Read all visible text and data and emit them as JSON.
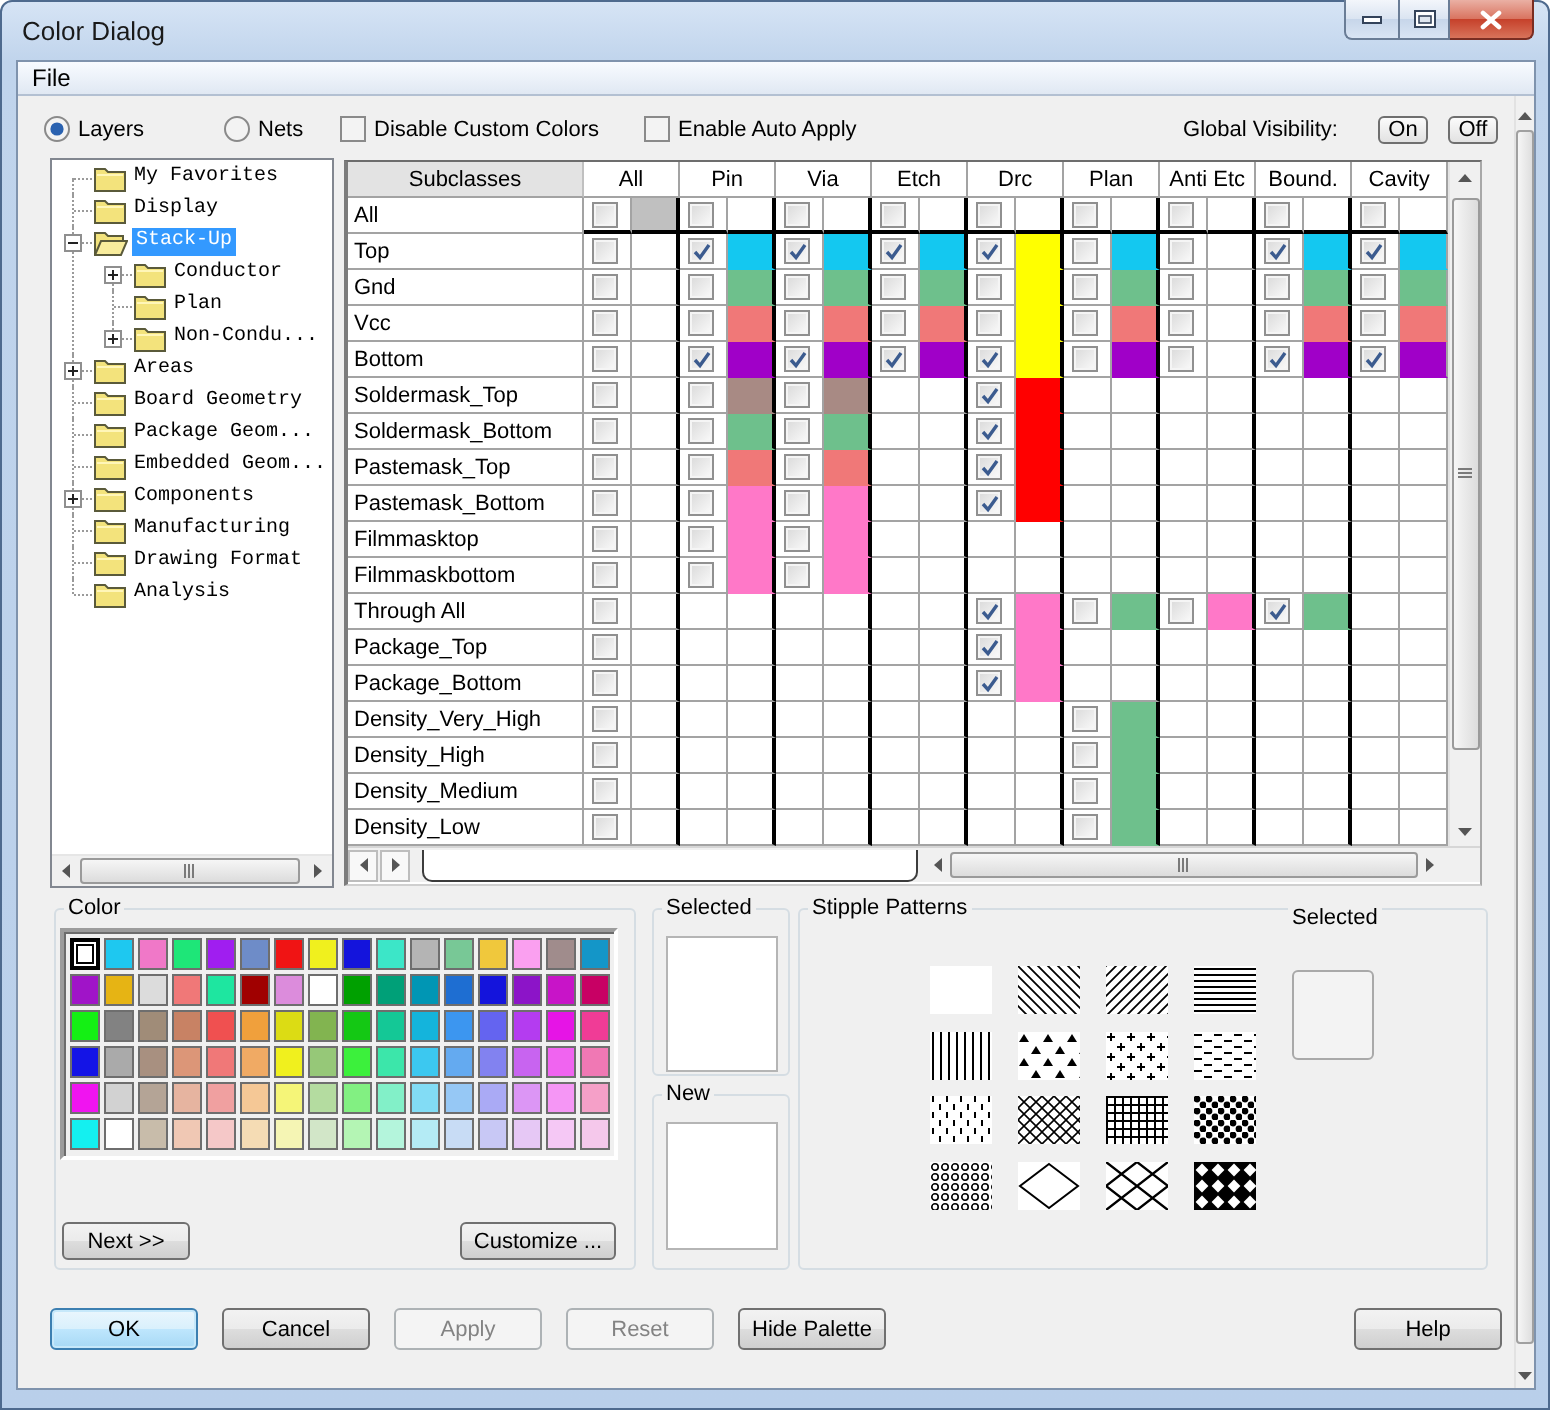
{
  "window": {
    "title": "Color Dialog"
  },
  "menu_bar": [
    "File"
  ],
  "view_options": [
    {
      "label": "Layers",
      "selected": true
    },
    {
      "label": "Nets",
      "selected": false
    }
  ],
  "options": [
    {
      "label": "Disable Custom Colors",
      "checked": false
    },
    {
      "label": "Enable Auto Apply",
      "checked": false
    }
  ],
  "global_visibility": {
    "label": "Global Visibility:",
    "buttons": [
      "On",
      "Off"
    ]
  },
  "tree": [
    {
      "label": "My Favorites",
      "selected": false
    },
    {
      "label": "Display",
      "selected": false
    },
    {
      "label": "Stack-Up",
      "selected": true,
      "expanded": true,
      "children": [
        {
          "label": "Conductor",
          "selected": false,
          "expanded": false
        },
        {
          "label": "Plan",
          "selected": false
        },
        {
          "label": "Non-Condu...",
          "selected": false,
          "expanded": false
        }
      ]
    },
    {
      "label": "Areas",
      "selected": false,
      "expanded": false
    },
    {
      "label": "Board Geometry",
      "selected": false
    },
    {
      "label": "Package Geom...",
      "selected": false
    },
    {
      "label": "Embedded Geom...",
      "selected": false
    },
    {
      "label": "Components",
      "selected": false,
      "expanded": false
    },
    {
      "label": "Manufacturing",
      "selected": false
    },
    {
      "label": "Drawing Format",
      "selected": false
    },
    {
      "label": "Analysis",
      "selected": false
    }
  ],
  "table": {
    "columns": [
      "Subclasses",
      "All",
      "Pin",
      "Via",
      "Etch",
      "Drc",
      "Plan",
      "Anti Etc",
      "Bound.",
      "Cavity"
    ],
    "rows": [
      {
        "name": "All",
        "cells": [
          {
            "kind": "toggle",
            "checked": false,
            "color": "#c0c0c0"
          },
          {
            "kind": "toggle",
            "checked": false
          },
          {
            "kind": "toggle",
            "checked": false
          },
          {
            "kind": "toggle",
            "checked": false
          },
          {
            "kind": "toggle",
            "checked": false
          },
          {
            "kind": "toggle",
            "checked": false
          },
          {
            "kind": "toggle",
            "checked": false
          },
          {
            "kind": "toggle",
            "checked": false
          },
          {
            "kind": "toggle",
            "checked": false
          }
        ]
      },
      {
        "name": "Top",
        "cells": [
          {
            "kind": "toggle",
            "checked": false
          },
          {
            "kind": "toggle",
            "checked": true,
            "color": "#14c8f0"
          },
          {
            "kind": "toggle",
            "checked": true,
            "color": "#14c8f0"
          },
          {
            "kind": "toggle",
            "checked": true,
            "color": "#14c8f0"
          },
          {
            "kind": "toggle",
            "checked": true,
            "color": "#ffff00"
          },
          {
            "kind": "toggle",
            "checked": false,
            "color": "#14c8f0"
          },
          {
            "kind": "toggle",
            "checked": false
          },
          {
            "kind": "toggle",
            "checked": true,
            "color": "#14c8f0"
          },
          {
            "kind": "toggle",
            "checked": true,
            "color": "#14c8f0"
          }
        ]
      },
      {
        "name": "Gnd",
        "cells": [
          {
            "kind": "toggle",
            "checked": false
          },
          {
            "kind": "toggle",
            "checked": false,
            "color": "#6ec08c"
          },
          {
            "kind": "toggle",
            "checked": false,
            "color": "#6ec08c"
          },
          {
            "kind": "toggle",
            "checked": false,
            "color": "#6ec08c"
          },
          {
            "kind": "toggle",
            "checked": false,
            "color": "#ffff00"
          },
          {
            "kind": "toggle",
            "checked": false,
            "color": "#6ec08c"
          },
          {
            "kind": "toggle",
            "checked": false
          },
          {
            "kind": "toggle",
            "checked": false,
            "color": "#6ec08c"
          },
          {
            "kind": "toggle",
            "checked": false,
            "color": "#6ec08c"
          }
        ]
      },
      {
        "name": "Vcc",
        "cells": [
          {
            "kind": "toggle",
            "checked": false
          },
          {
            "kind": "toggle",
            "checked": false,
            "color": "#f07878"
          },
          {
            "kind": "toggle",
            "checked": false,
            "color": "#f07878"
          },
          {
            "kind": "toggle",
            "checked": false,
            "color": "#f07878"
          },
          {
            "kind": "toggle",
            "checked": false,
            "color": "#ffff00"
          },
          {
            "kind": "toggle",
            "checked": false,
            "color": "#f07878"
          },
          {
            "kind": "toggle",
            "checked": false
          },
          {
            "kind": "toggle",
            "checked": false,
            "color": "#f07878"
          },
          {
            "kind": "toggle",
            "checked": false,
            "color": "#f07878"
          }
        ]
      },
      {
        "name": "Bottom",
        "cells": [
          {
            "kind": "toggle",
            "checked": false
          },
          {
            "kind": "toggle",
            "checked": true,
            "color": "#a000c8"
          },
          {
            "kind": "toggle",
            "checked": true,
            "color": "#a000c8"
          },
          {
            "kind": "toggle",
            "checked": true,
            "color": "#a000c8"
          },
          {
            "kind": "toggle",
            "checked": true,
            "color": "#ffff00"
          },
          {
            "kind": "toggle",
            "checked": false,
            "color": "#a000c8"
          },
          {
            "kind": "toggle",
            "checked": false
          },
          {
            "kind": "toggle",
            "checked": true,
            "color": "#a000c8"
          },
          {
            "kind": "toggle",
            "checked": true,
            "color": "#a000c8"
          }
        ]
      },
      {
        "name": "Soldermask_Top",
        "cells": [
          {
            "kind": "toggle",
            "checked": false
          },
          {
            "kind": "toggle",
            "checked": false,
            "color": "#a88a84"
          },
          {
            "kind": "toggle",
            "checked": false,
            "color": "#a88a84"
          },
          {
            "kind": "blank"
          },
          {
            "kind": "toggle",
            "checked": true,
            "color": "#ff0000"
          },
          {
            "kind": "blank"
          },
          {
            "kind": "blank"
          },
          {
            "kind": "blank"
          },
          {
            "kind": "blank"
          }
        ]
      },
      {
        "name": "Soldermask_Bottom",
        "cells": [
          {
            "kind": "toggle",
            "checked": false
          },
          {
            "kind": "toggle",
            "checked": false,
            "color": "#6ec08c"
          },
          {
            "kind": "toggle",
            "checked": false,
            "color": "#6ec08c"
          },
          {
            "kind": "blank"
          },
          {
            "kind": "toggle",
            "checked": true,
            "color": "#ff0000"
          },
          {
            "kind": "blank"
          },
          {
            "kind": "blank"
          },
          {
            "kind": "blank"
          },
          {
            "kind": "blank"
          }
        ]
      },
      {
        "name": "Pastemask_Top",
        "cells": [
          {
            "kind": "toggle",
            "checked": false
          },
          {
            "kind": "toggle",
            "checked": false,
            "color": "#f07878"
          },
          {
            "kind": "toggle",
            "checked": false,
            "color": "#f07878"
          },
          {
            "kind": "blank"
          },
          {
            "kind": "toggle",
            "checked": true,
            "color": "#ff0000"
          },
          {
            "kind": "blank"
          },
          {
            "kind": "blank"
          },
          {
            "kind": "blank"
          },
          {
            "kind": "blank"
          }
        ]
      },
      {
        "name": "Pastemask_Bottom",
        "cells": [
          {
            "kind": "toggle",
            "checked": false
          },
          {
            "kind": "toggle",
            "checked": false,
            "color": "#ff78c8"
          },
          {
            "kind": "toggle",
            "checked": false,
            "color": "#ff78c8"
          },
          {
            "kind": "blank"
          },
          {
            "kind": "toggle",
            "checked": true,
            "color": "#ff0000"
          },
          {
            "kind": "blank"
          },
          {
            "kind": "blank"
          },
          {
            "kind": "blank"
          },
          {
            "kind": "blank"
          }
        ]
      },
      {
        "name": "Filmmasktop",
        "cells": [
          {
            "kind": "toggle",
            "checked": false
          },
          {
            "kind": "toggle",
            "checked": false,
            "color": "#ff78c8"
          },
          {
            "kind": "toggle",
            "checked": false,
            "color": "#ff78c8"
          },
          {
            "kind": "blank"
          },
          {
            "kind": "blank"
          },
          {
            "kind": "blank"
          },
          {
            "kind": "blank"
          },
          {
            "kind": "blank"
          },
          {
            "kind": "blank"
          }
        ]
      },
      {
        "name": "Filmmaskbottom",
        "cells": [
          {
            "kind": "toggle",
            "checked": false
          },
          {
            "kind": "toggle",
            "checked": false,
            "color": "#ff78c8"
          },
          {
            "kind": "toggle",
            "checked": false,
            "color": "#ff78c8"
          },
          {
            "kind": "blank"
          },
          {
            "kind": "blank"
          },
          {
            "kind": "blank"
          },
          {
            "kind": "blank"
          },
          {
            "kind": "blank"
          },
          {
            "kind": "blank"
          }
        ]
      },
      {
        "name": "Through All",
        "cells": [
          {
            "kind": "toggle",
            "checked": false
          },
          {
            "kind": "blank"
          },
          {
            "kind": "blank"
          },
          {
            "kind": "blank"
          },
          {
            "kind": "toggle",
            "checked": true,
            "color": "#ff78c8"
          },
          {
            "kind": "toggle",
            "checked": false,
            "color": "#6ec08c"
          },
          {
            "kind": "toggle",
            "checked": false,
            "color": "#ff78c8"
          },
          {
            "kind": "toggle",
            "checked": true,
            "color": "#6ec08c"
          },
          {
            "kind": "blank"
          }
        ]
      },
      {
        "name": "Package_Top",
        "cells": [
          {
            "kind": "toggle",
            "checked": false
          },
          {
            "kind": "blank"
          },
          {
            "kind": "blank"
          },
          {
            "kind": "blank"
          },
          {
            "kind": "toggle",
            "checked": true,
            "color": "#ff78c8"
          },
          {
            "kind": "blank"
          },
          {
            "kind": "blank"
          },
          {
            "kind": "blank"
          },
          {
            "kind": "blank"
          }
        ]
      },
      {
        "name": "Package_Bottom",
        "cells": [
          {
            "kind": "toggle",
            "checked": false
          },
          {
            "kind": "blank"
          },
          {
            "kind": "blank"
          },
          {
            "kind": "blank"
          },
          {
            "kind": "toggle",
            "checked": true,
            "color": "#ff78c8"
          },
          {
            "kind": "blank"
          },
          {
            "kind": "blank"
          },
          {
            "kind": "blank"
          },
          {
            "kind": "blank"
          }
        ]
      },
      {
        "name": "Density_Very_High",
        "cells": [
          {
            "kind": "toggle",
            "checked": false
          },
          {
            "kind": "blank"
          },
          {
            "kind": "blank"
          },
          {
            "kind": "blank"
          },
          {
            "kind": "blank"
          },
          {
            "kind": "toggle",
            "checked": false,
            "color": "#6ec08c"
          },
          {
            "kind": "blank"
          },
          {
            "kind": "blank"
          },
          {
            "kind": "blank"
          }
        ]
      },
      {
        "name": "Density_High",
        "cells": [
          {
            "kind": "toggle",
            "checked": false
          },
          {
            "kind": "blank"
          },
          {
            "kind": "blank"
          },
          {
            "kind": "blank"
          },
          {
            "kind": "blank"
          },
          {
            "kind": "toggle",
            "checked": false,
            "color": "#6ec08c"
          },
          {
            "kind": "blank"
          },
          {
            "kind": "blank"
          },
          {
            "kind": "blank"
          }
        ]
      },
      {
        "name": "Density_Medium",
        "cells": [
          {
            "kind": "toggle",
            "checked": false
          },
          {
            "kind": "blank"
          },
          {
            "kind": "blank"
          },
          {
            "kind": "blank"
          },
          {
            "kind": "blank"
          },
          {
            "kind": "toggle",
            "checked": false,
            "color": "#6ec08c"
          },
          {
            "kind": "blank"
          },
          {
            "kind": "blank"
          },
          {
            "kind": "blank"
          }
        ]
      },
      {
        "name": "Density_Low",
        "cells": [
          {
            "kind": "toggle",
            "checked": false
          },
          {
            "kind": "blank"
          },
          {
            "kind": "blank"
          },
          {
            "kind": "blank"
          },
          {
            "kind": "blank"
          },
          {
            "kind": "toggle",
            "checked": false,
            "color": "#6ec08c"
          },
          {
            "kind": "blank"
          },
          {
            "kind": "blank"
          },
          {
            "kind": "blank"
          }
        ]
      }
    ]
  },
  "color_palette": {
    "title": "Color",
    "swatches": [
      {
        "color": "#ffffff",
        "selected": true
      },
      {
        "color": "#1ec8f0",
        "selected": false
      },
      {
        "color": "#f078c8",
        "selected": false
      },
      {
        "color": "#1ee678",
        "selected": false
      },
      {
        "color": "#a01ef0",
        "selected": false
      },
      {
        "color": "#6e8cc8",
        "selected": false
      },
      {
        "color": "#f01414",
        "selected": false
      },
      {
        "color": "#f0f01e",
        "selected": false
      },
      {
        "color": "#1414dc",
        "selected": false
      },
      {
        "color": "#3ce6c8",
        "selected": false
      },
      {
        "color": "#b4b4b4",
        "selected": false
      },
      {
        "color": "#78c896",
        "selected": false
      },
      {
        "color": "#f0c83c",
        "selected": false
      },
      {
        "color": "#faa0f0",
        "selected": false
      },
      {
        "color": "#a08c8c",
        "selected": false
      },
      {
        "color": "#1496c8",
        "selected": false
      },
      {
        "color": "#a014c8",
        "selected": false
      },
      {
        "color": "#e6b414",
        "selected": false
      },
      {
        "color": "#dcdcdc",
        "selected": false
      },
      {
        "color": "#f07878",
        "selected": false
      },
      {
        "color": "#1ee6a0",
        "selected": false
      },
      {
        "color": "#a00000",
        "selected": false
      },
      {
        "color": "#dc8cdc",
        "selected": false
      },
      {
        "color": "#ffffff",
        "selected": false
      },
      {
        "color": "#00a000",
        "selected": false
      },
      {
        "color": "#00a078",
        "selected": false
      },
      {
        "color": "#0096b4",
        "selected": false
      },
      {
        "color": "#1e6ed2",
        "selected": false
      },
      {
        "color": "#1414dc",
        "selected": false
      },
      {
        "color": "#8c14c8",
        "selected": false
      },
      {
        "color": "#c814c8",
        "selected": false
      },
      {
        "color": "#c80064",
        "selected": false
      },
      {
        "color": "#14f014",
        "selected": false
      },
      {
        "color": "#828282",
        "selected": false
      },
      {
        "color": "#a08c78",
        "selected": false
      },
      {
        "color": "#c88264",
        "selected": false
      },
      {
        "color": "#f05050",
        "selected": false
      },
      {
        "color": "#f0a03c",
        "selected": false
      },
      {
        "color": "#dcdc14",
        "selected": false
      },
      {
        "color": "#82b450",
        "selected": false
      },
      {
        "color": "#14c814",
        "selected": false
      },
      {
        "color": "#14c896",
        "selected": false
      },
      {
        "color": "#14b4dc",
        "selected": false
      },
      {
        "color": "#3c96f0",
        "selected": false
      },
      {
        "color": "#6464f0",
        "selected": false
      },
      {
        "color": "#b43cf0",
        "selected": false
      },
      {
        "color": "#e614e6",
        "selected": false
      },
      {
        "color": "#f03c96",
        "selected": false
      },
      {
        "color": "#1414e6",
        "selected": false
      },
      {
        "color": "#aaaaaa",
        "selected": false
      },
      {
        "color": "#a89080",
        "selected": false
      },
      {
        "color": "#dc9678",
        "selected": false
      },
      {
        "color": "#f07878",
        "selected": false
      },
      {
        "color": "#f0aa64",
        "selected": false
      },
      {
        "color": "#f0f01e",
        "selected": false
      },
      {
        "color": "#96c878",
        "selected": false
      },
      {
        "color": "#3cf03c",
        "selected": false
      },
      {
        "color": "#3ce6aa",
        "selected": false
      },
      {
        "color": "#3cc8f0",
        "selected": false
      },
      {
        "color": "#64aaf0",
        "selected": false
      },
      {
        "color": "#8282f0",
        "selected": false
      },
      {
        "color": "#c864f0",
        "selected": false
      },
      {
        "color": "#f064f0",
        "selected": false
      },
      {
        "color": "#f078b4",
        "selected": false
      },
      {
        "color": "#f014f0",
        "selected": false
      },
      {
        "color": "#d2d2d2",
        "selected": false
      },
      {
        "color": "#b4a496",
        "selected": false
      },
      {
        "color": "#e6b4a0",
        "selected": false
      },
      {
        "color": "#f0a0a0",
        "selected": false
      },
      {
        "color": "#f5c896",
        "selected": false
      },
      {
        "color": "#f5f578",
        "selected": false
      },
      {
        "color": "#b4dca0",
        "selected": false
      },
      {
        "color": "#82f082",
        "selected": false
      },
      {
        "color": "#82f0c8",
        "selected": false
      },
      {
        "color": "#82dcf5",
        "selected": false
      },
      {
        "color": "#96c8f5",
        "selected": false
      },
      {
        "color": "#aaaaf5",
        "selected": false
      },
      {
        "color": "#dc96f5",
        "selected": false
      },
      {
        "color": "#f596f5",
        "selected": false
      },
      {
        "color": "#f5a0c8",
        "selected": false
      },
      {
        "color": "#14f0f0",
        "selected": false
      },
      {
        "color": "#ffffff",
        "selected": false
      },
      {
        "color": "#c8bcaa",
        "selected": false
      },
      {
        "color": "#f0c8b4",
        "selected": false
      },
      {
        "color": "#f5c8c8",
        "selected": false
      },
      {
        "color": "#f5dcb4",
        "selected": false
      },
      {
        "color": "#f5f5b4",
        "selected": false
      },
      {
        "color": "#d2e6c8",
        "selected": false
      },
      {
        "color": "#b4f5b4",
        "selected": false
      },
      {
        "color": "#b4f5dc",
        "selected": false
      },
      {
        "color": "#b4ebf5",
        "selected": false
      },
      {
        "color": "#c8dcf5",
        "selected": false
      },
      {
        "color": "#c8c8f5",
        "selected": false
      },
      {
        "color": "#e6c8f5",
        "selected": false
      },
      {
        "color": "#f5c8f5",
        "selected": false
      },
      {
        "color": "#f5c8eb",
        "selected": false
      }
    ],
    "buttons": [
      "Next >>",
      "Customize ..."
    ]
  },
  "selected_color": {
    "title": "Selected"
  },
  "new_color": {
    "title": "New"
  },
  "stipple_patterns": {
    "title": "Stipple Patterns",
    "selected_title": "Selected",
    "patterns": [
      {
        "kind": "blank"
      },
      {
        "kind": "backslash"
      },
      {
        "kind": "slash"
      },
      {
        "kind": "horizontal"
      },
      {
        "kind": "vertical"
      },
      {
        "kind": "triangles"
      },
      {
        "kind": "crosses"
      },
      {
        "kind": "dashes"
      },
      {
        "kind": "ticks"
      },
      {
        "kind": "crosshatch"
      },
      {
        "kind": "grid"
      },
      {
        "kind": "dots"
      },
      {
        "kind": "rings"
      },
      {
        "kind": "diamond"
      },
      {
        "kind": "lattice"
      },
      {
        "kind": "checker"
      }
    ]
  },
  "buttons": [
    {
      "label": "OK",
      "default": true,
      "disabled": false
    },
    {
      "label": "Cancel",
      "default": false,
      "disabled": false
    },
    {
      "label": "Apply",
      "default": false,
      "disabled": true
    },
    {
      "label": "Reset",
      "default": false,
      "disabled": true
    },
    {
      "label": "Hide Palette",
      "default": false,
      "disabled": false
    }
  ],
  "help_button": {
    "label": "Help"
  }
}
